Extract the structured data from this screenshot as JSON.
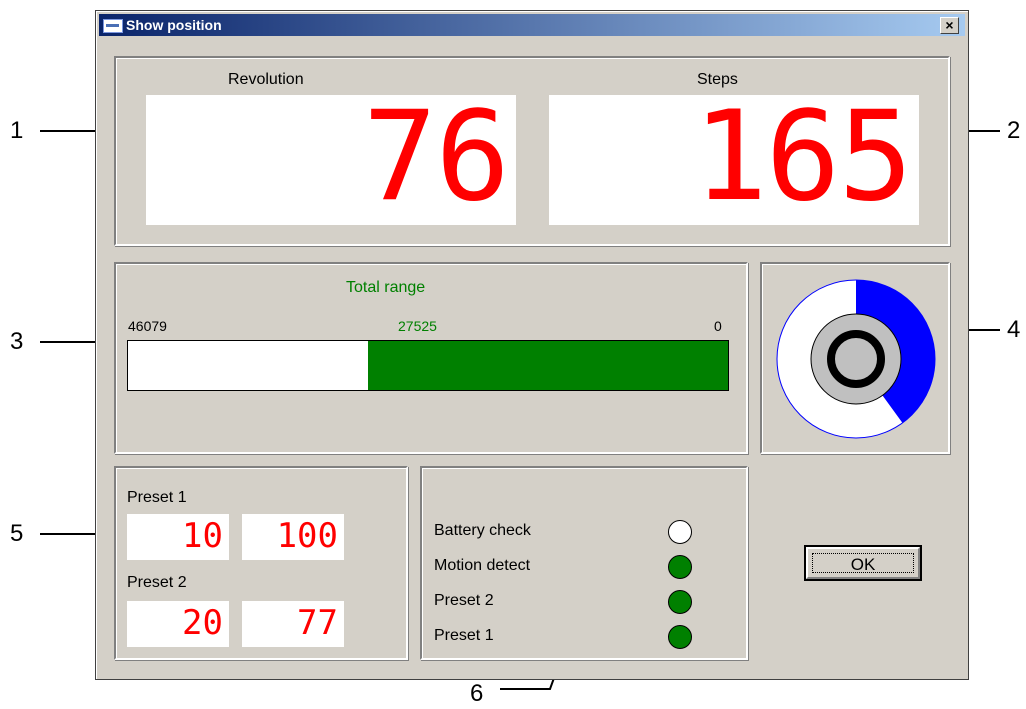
{
  "window": {
    "title": "Show position",
    "close_label": "×"
  },
  "position": {
    "revolution_label": "Revolution",
    "revolution_value": "76",
    "steps_label": "Steps",
    "steps_value": "165"
  },
  "total_range": {
    "label": "Total range",
    "max_label": "46079",
    "current_label": "27525",
    "min_label": "0",
    "fill_fraction": 0.6,
    "label_color": "#008000",
    "fill_color": "#008000"
  },
  "dial": {
    "fill_fraction": 0.4,
    "fill_color": "#0000ff"
  },
  "presets": {
    "preset1_label": "Preset 1",
    "preset1_rev": "10",
    "preset1_steps": "100",
    "preset2_label": "Preset 2",
    "preset2_rev": "20",
    "preset2_steps": "77"
  },
  "status": {
    "items": [
      {
        "label": "Battery check",
        "state": "off",
        "color": "#ffffff"
      },
      {
        "label": "Motion detect",
        "state": "on",
        "color": "#008000"
      },
      {
        "label": "Preset 2",
        "state": "on",
        "color": "#008000"
      },
      {
        "label": "Preset 1",
        "state": "on",
        "color": "#008000"
      }
    ]
  },
  "ok_label": "OK",
  "callouts": {
    "c1": "1",
    "c2": "2",
    "c3": "3",
    "c4": "4",
    "c5": "5",
    "c6": "6"
  }
}
